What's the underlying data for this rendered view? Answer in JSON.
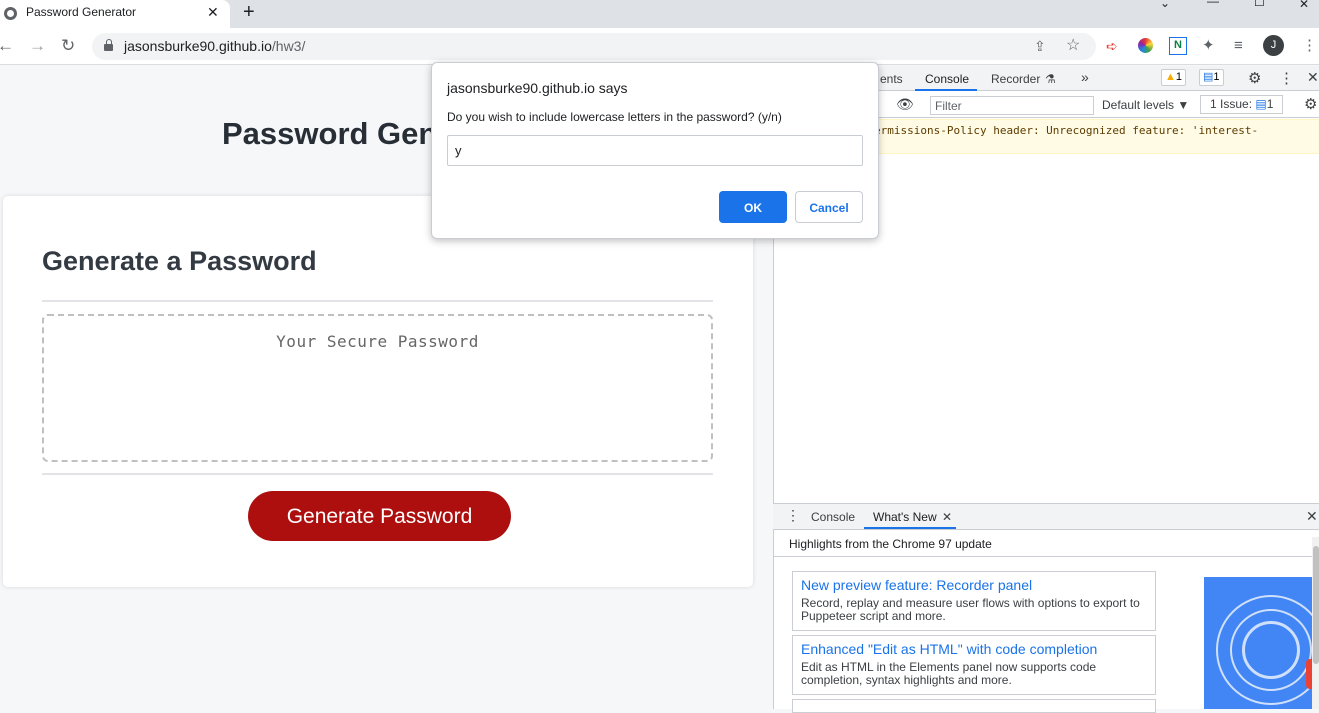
{
  "browser": {
    "tab_title": "Password Generator",
    "tab_close": "✕",
    "new_tab": "+",
    "url_host": "jasonsburke90.github.io",
    "url_path": "/hw3/",
    "avatar_initial": "J",
    "extension_n": "N",
    "window_controls": [
      "⌄",
      "—",
      "☐",
      "✕"
    ]
  },
  "page": {
    "heading": "Password Generator",
    "card_title": "Generate a Password",
    "password_placeholder": "Your Secure Password",
    "generate_label": "Generate Password"
  },
  "dialog": {
    "title": "jasonsburke90.github.io says",
    "message": "Do you wish to include lowercase letters in the password? (y/n)",
    "input_value": "y",
    "ok_label": "OK",
    "cancel_label": "Cancel"
  },
  "devtools": {
    "tabs": [
      "ents",
      "Console",
      "Recorder",
      "»"
    ],
    "warnings_count": "1",
    "messages_count": "1",
    "filter_placeholder": "Filter",
    "default_levels": "Default levels ▼",
    "issues_label": "1 Issue:",
    "issues_count": "1",
    "warning_text": "ermissions-Policy header: Unrecognized feature: 'interest-",
    "drawer_tabs": [
      "Console",
      "What's New"
    ],
    "drawer_close": "✕",
    "highlights": "Highlights from the Chrome 97 update",
    "features": [
      {
        "title": "New preview feature: Recorder panel",
        "desc": "Record, replay and measure user flows with options to export to Puppeteer script and more."
      },
      {
        "title": "Enhanced \"Edit as HTML\" with code completion",
        "desc": "Edit as HTML in the Elements panel now supports code completion, syntax highlights and more."
      }
    ]
  },
  "colors": {
    "generate_button": "#ad0f0f",
    "ok_button": "#1a73e8",
    "link": "#1a73e8"
  }
}
